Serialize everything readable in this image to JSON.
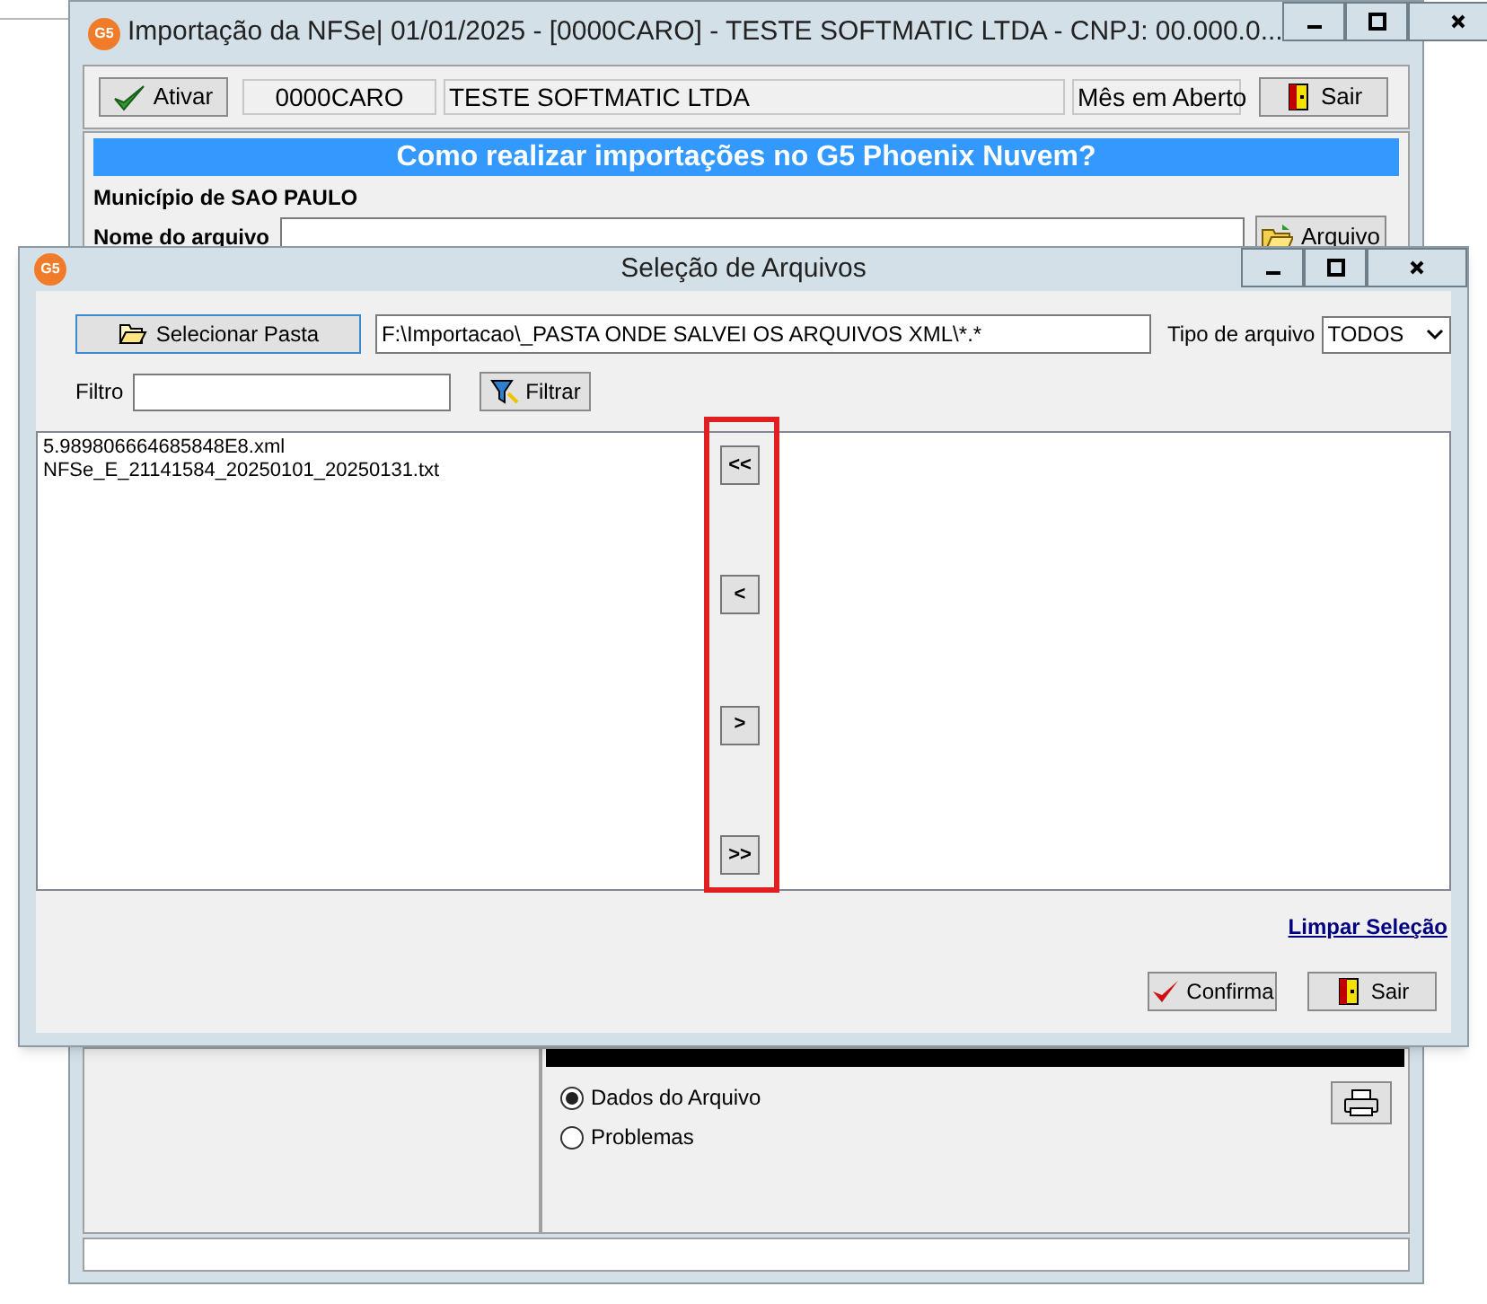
{
  "main_window": {
    "icon_label": "G5",
    "title": "Importação da NFSe| 01/01/2025 - [0000CARO] - TESTE SOFTMATIC LTDA - CNPJ: 00.000.0...",
    "toolbar": {
      "activate_button": "Ativar",
      "company_code": "0000CARO",
      "company_name": "TESTE SOFTMATIC LTDA",
      "period_status": "Mês em Aberto",
      "exit_button": "Sair"
    },
    "banner": "Como realizar importações no G5 Phoenix Nuvem?",
    "municipality": "Município de SAO PAULO",
    "file_name": {
      "label": "Nome do arquivo",
      "button": "Arquivo"
    },
    "report": {
      "options": [
        {
          "label": "Dados do Arquivo",
          "selected": true
        },
        {
          "label": "Problemas",
          "selected": false
        }
      ]
    }
  },
  "dialog": {
    "icon_label": "G5",
    "title": "Seleção de Arquivos",
    "select_folder_button": "Selecionar Pasta",
    "path": "F:\\Importacao\\_PASTA ONDE SALVEI OS ARQUIVOS XML\\*.*",
    "file_type": {
      "label": "Tipo de arquivo",
      "value": "TODOS"
    },
    "filter": {
      "label": "Filtro",
      "button": "Filtrar"
    },
    "available_files": [
      "5.989806664685848E8.xml",
      "NFSe_E_21141584_20250101_20250131.txt"
    ],
    "move_buttons": [
      "<<",
      "<",
      ">",
      ">>"
    ],
    "clear_link": "Limpar Seleção",
    "confirm_button": "Confirma",
    "exit_button": "Sair"
  }
}
